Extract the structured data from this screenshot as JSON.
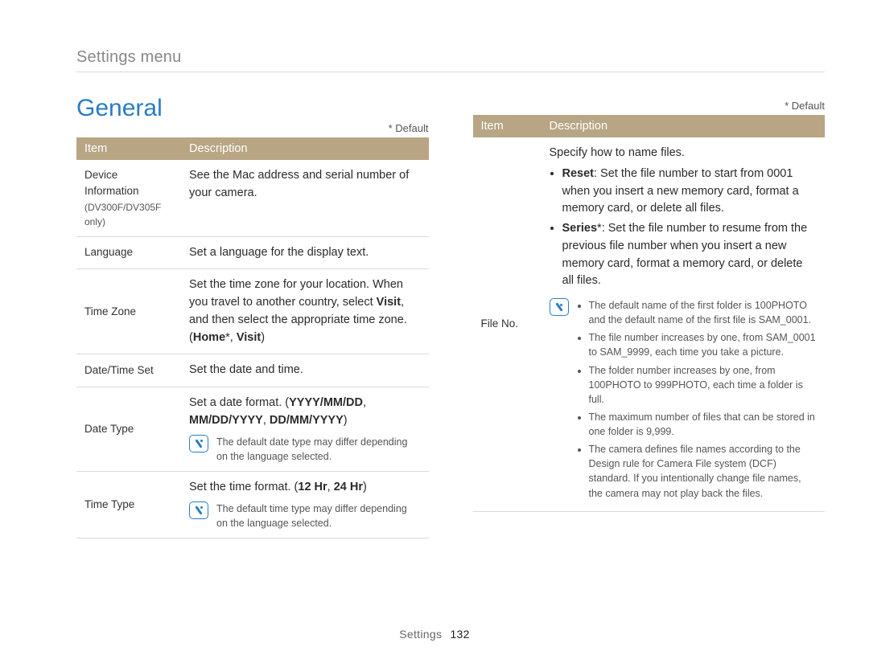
{
  "breadcrumb": "Settings menu",
  "section_title": "General",
  "default_marker": "* Default",
  "table_headers": {
    "item": "Item",
    "description": "Description"
  },
  "left_rows": {
    "device_info": {
      "item": "Device Information",
      "item_sub": "(DV300F/DV305F only)",
      "desc": "See the Mac address and serial number of your camera."
    },
    "language": {
      "item": "Language",
      "desc": "Set a language for the display text."
    },
    "time_zone": {
      "item": "Time Zone",
      "desc_pre": "Set the time zone for your location. When you travel to another country, select ",
      "visit": "Visit",
      "desc_mid": ", and then select the appropriate time zone.",
      "paren_open": "(",
      "home": "Home",
      "star": "*",
      "sep": ", ",
      "visit2": "Visit",
      "paren_close": ")"
    },
    "date_time_set": {
      "item": "Date/Time Set",
      "desc": "Set the date and time."
    },
    "date_type": {
      "item": "Date Type",
      "desc_pre": "Set a date format. (",
      "opt1": "YYYY/MM/DD",
      "sep": ", ",
      "opt2": "MM/DD/YYYY",
      "opt3": "DD/MM/YYYY",
      "desc_post": ")",
      "note": "The default date type may differ depending on the language selected."
    },
    "time_type": {
      "item": "Time Type",
      "desc_pre": "Set the time format. (",
      "opt1": "12 Hr",
      "sep": ", ",
      "opt2": "24 Hr",
      "desc_post": ")",
      "note": "The default time type may differ depending on the language selected."
    }
  },
  "right_rows": {
    "file_no": {
      "item": "File No.",
      "heading": "Specify how to name files.",
      "reset_label": "Reset",
      "reset_desc": ": Set the file number to start from 0001 when you insert a new memory card, format a memory card, or delete all files.",
      "series_label": "Series",
      "series_star": "*",
      "series_desc": ": Set the file number to resume from the previous file number when you insert a new memory card, format a memory card, or delete all files.",
      "notes": {
        "n1": "The default name of the first folder is 100PHOTO and the default name of the first file is SAM_0001.",
        "n2": "The file number increases by one, from SAM_0001 to SAM_9999, each time you take a picture.",
        "n3": "The folder number increases by one, from 100PHOTO to 999PHOTO, each time a folder is full.",
        "n4": "The maximum number of files that can be stored in one folder is 9,999.",
        "n5": "The camera defines file names according to the Design rule for Camera File system (DCF) standard. If you intentionally change file names, the camera may not play back the files."
      }
    }
  },
  "footer": {
    "section": "Settings",
    "page": "132"
  }
}
